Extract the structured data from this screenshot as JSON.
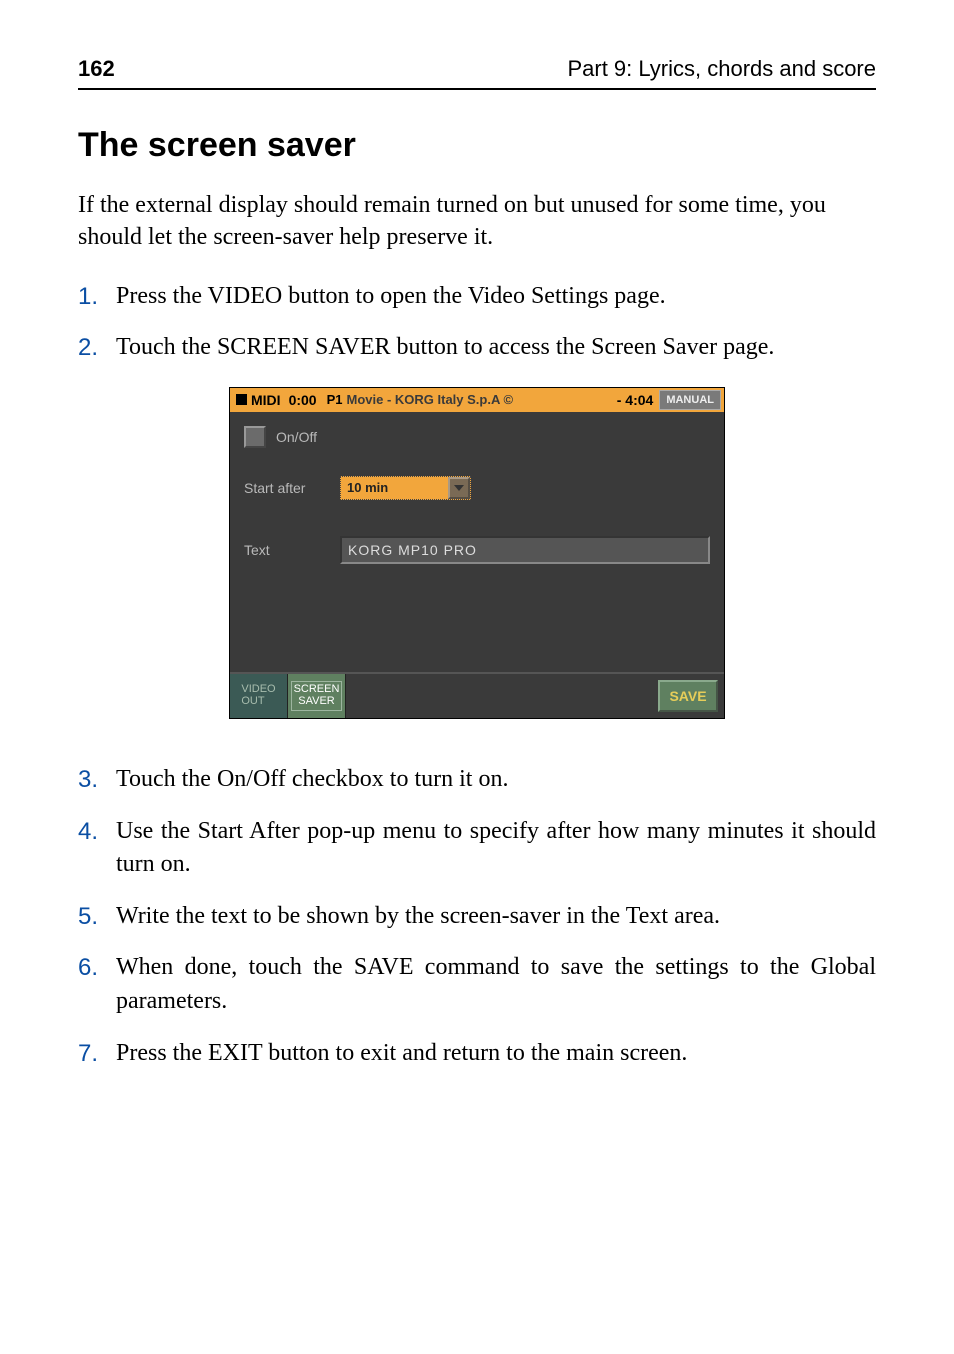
{
  "header": {
    "page_number": "162",
    "part_title": "Part 9: Lyrics, chords and score"
  },
  "section_title": "The screen saver",
  "intro_para": "If the external display should remain turned on but unused for some time, you should let the screen-saver help preserve it.",
  "steps_a": [
    {
      "num": "1.",
      "text": "Press the VIDEO button to open the Video Settings page."
    },
    {
      "num": "2.",
      "text": "Touch the SCREEN SAVER button to access the Screen Saver page."
    }
  ],
  "steps_b": [
    {
      "num": "3.",
      "text": "Touch the On/Off checkbox to turn it on."
    },
    {
      "num": "4.",
      "text": "Use the Start After pop-up menu to specify after how many minutes it should turn on."
    },
    {
      "num": "5.",
      "text": "Write the text to be shown by the screen-saver in the Text area."
    },
    {
      "num": "6.",
      "text": "When done, touch the SAVE command to save the settings to the Global parameters."
    },
    {
      "num": "7.",
      "text": "Press the EXIT button to exit and return to the main screen."
    }
  ],
  "screenshot": {
    "top": {
      "midi": "MIDI",
      "time_left": "0:00",
      "title_prefix": "P1",
      "title": "Movie - KORG Italy S.p.A ©",
      "time_right": "- 4:04",
      "manual": "MANUAL"
    },
    "body": {
      "onoff_label": "On/Off",
      "start_after_label": "Start after",
      "start_after_value": "10 min",
      "text_label": "Text",
      "text_value": "KORG MP10 PRO"
    },
    "bottom": {
      "tab1_line1": "VIDEO",
      "tab1_line2": "OUT",
      "tab2_line1": "SCREEN",
      "tab2_line2": "SAVER",
      "save": "SAVE"
    }
  }
}
